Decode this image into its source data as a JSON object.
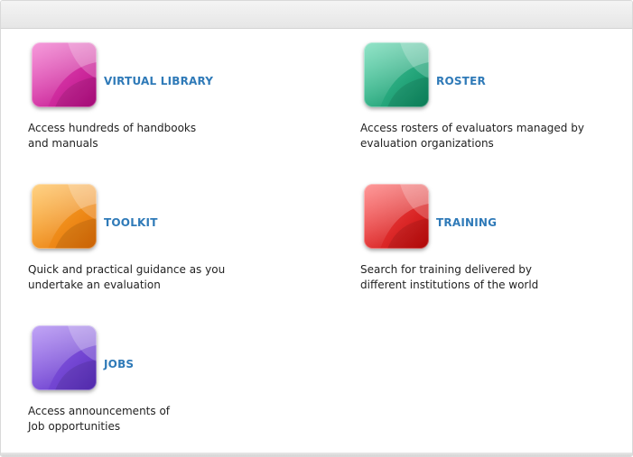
{
  "tiles": [
    {
      "key": "virtual-library",
      "label": "VIRTUAL LIBRARY",
      "desc": [
        "Access hundreds of handbooks",
        "and manuals"
      ],
      "color_light": "#f05cc4",
      "color_dark": "#b80a84",
      "icon": "virtual-library-icon"
    },
    {
      "key": "roster",
      "label": "ROSTER",
      "desc": [
        "Access rosters of evaluators managed by",
        "evaluation organizations"
      ],
      "color_light": "#4fd3a6",
      "color_dark": "#0b8a60",
      "icon": "roster-icon"
    },
    {
      "key": "toolkit",
      "label": "TOOLKIT",
      "desc": [
        "Quick and practical guidance as you",
        "undertake an evaluation"
      ],
      "color_light": "#ffb637",
      "color_dark": "#e36d04",
      "icon": "toolkit-icon"
    },
    {
      "key": "training",
      "label": "TRAINING",
      "desc": [
        "Search for training delivered by",
        "different institutions of the world"
      ],
      "color_light": "#ff5a5a",
      "color_dark": "#c40707",
      "icon": "training-icon"
    },
    {
      "key": "jobs",
      "label": "JOBS",
      "desc": [
        "Access announcements of",
        "Job opportunities"
      ],
      "color_light": "#9a6cf0",
      "color_dark": "#5a2ec0",
      "icon": "jobs-icon"
    }
  ],
  "colors": {
    "link": "#2f7ab8",
    "text": "#222222"
  }
}
